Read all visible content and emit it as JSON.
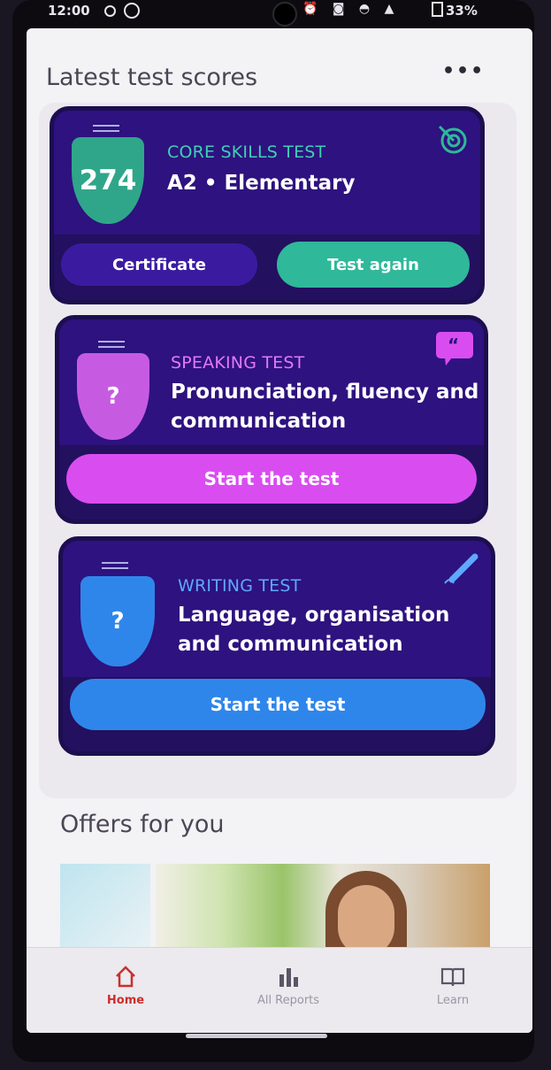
{
  "status_bar": {
    "time": "12:00",
    "battery": "33%"
  },
  "scores_section": {
    "title": "Latest test scores",
    "more_label": "•••"
  },
  "core_card": {
    "score": "274",
    "label": "CORE SKILLS TEST",
    "level": "A2 • Elementary",
    "certificate_label": "Certificate",
    "test_again_label": "Test again",
    "colors": {
      "accent": "#2fb89a",
      "label": "#3ed0b4"
    }
  },
  "speaking_card": {
    "badge": "?",
    "label": "SPEAKING TEST",
    "headline_line1": "Pronunciation, fluency and",
    "headline_line2": "communication",
    "start_label": "Start the test",
    "colors": {
      "accent": "#d94df0",
      "label": "#e479f5"
    }
  },
  "writing_card": {
    "badge": "?",
    "label": "WRITING TEST",
    "headline_line1": "Language, organisation",
    "headline_line2": "and communication",
    "start_label": "Start the test",
    "colors": {
      "accent": "#2f86ea",
      "label": "#5fa8ff"
    }
  },
  "offers_section": {
    "title": "Offers for you"
  },
  "bottom_nav": {
    "items": [
      {
        "label": "Home",
        "icon": "home-icon",
        "active": true
      },
      {
        "label": "All Reports",
        "icon": "bar-chart-icon",
        "active": false
      },
      {
        "label": "Learn",
        "icon": "book-icon",
        "active": false
      }
    ],
    "active_color": "#c9302c"
  }
}
